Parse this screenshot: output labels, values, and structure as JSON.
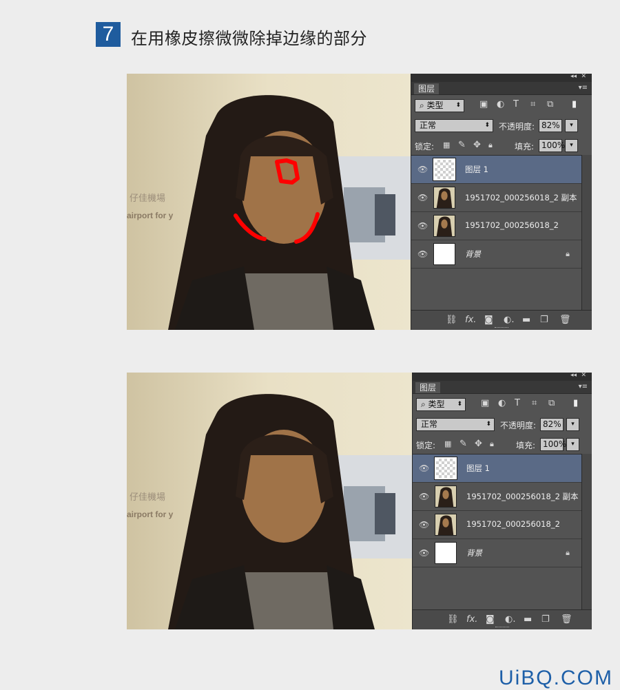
{
  "step": {
    "number": "7",
    "title": "在用橡皮擦微微除掉边缘的部分"
  },
  "panel_labels": {
    "tab": "图层",
    "filter_kind": "类型",
    "blend_mode": "正常",
    "opacity_label": "不透明度:",
    "opacity_value": "82%",
    "lock_label": "锁定:",
    "fill_label": "填充:",
    "fill_value": "100%"
  },
  "layers": [
    {
      "name": "图层 1",
      "active": true
    },
    {
      "name": "1951702_000256018_2 副本",
      "active": false
    },
    {
      "name": "1951702_000256018_2",
      "active": false
    },
    {
      "name": "背景",
      "active": false,
      "locked": true
    }
  ],
  "photo_sign_text": {
    "line1": "仔佳機場",
    "line2": "airport for y"
  },
  "icons": {
    "filter_icons": [
      "image-filter-icon",
      "adjustment-filter-icon",
      "type-filter-icon",
      "shape-filter-icon",
      "smart-object-filter-icon"
    ],
    "bottom_icons": [
      "link-icon",
      "fx-icon",
      "mask-icon",
      "adjustment-icon",
      "folder-icon",
      "new-layer-icon",
      "trash-icon"
    ]
  },
  "annotation_color": "#ff0000",
  "watermark": {
    "left": "UiBQ",
    "right": "COM"
  }
}
